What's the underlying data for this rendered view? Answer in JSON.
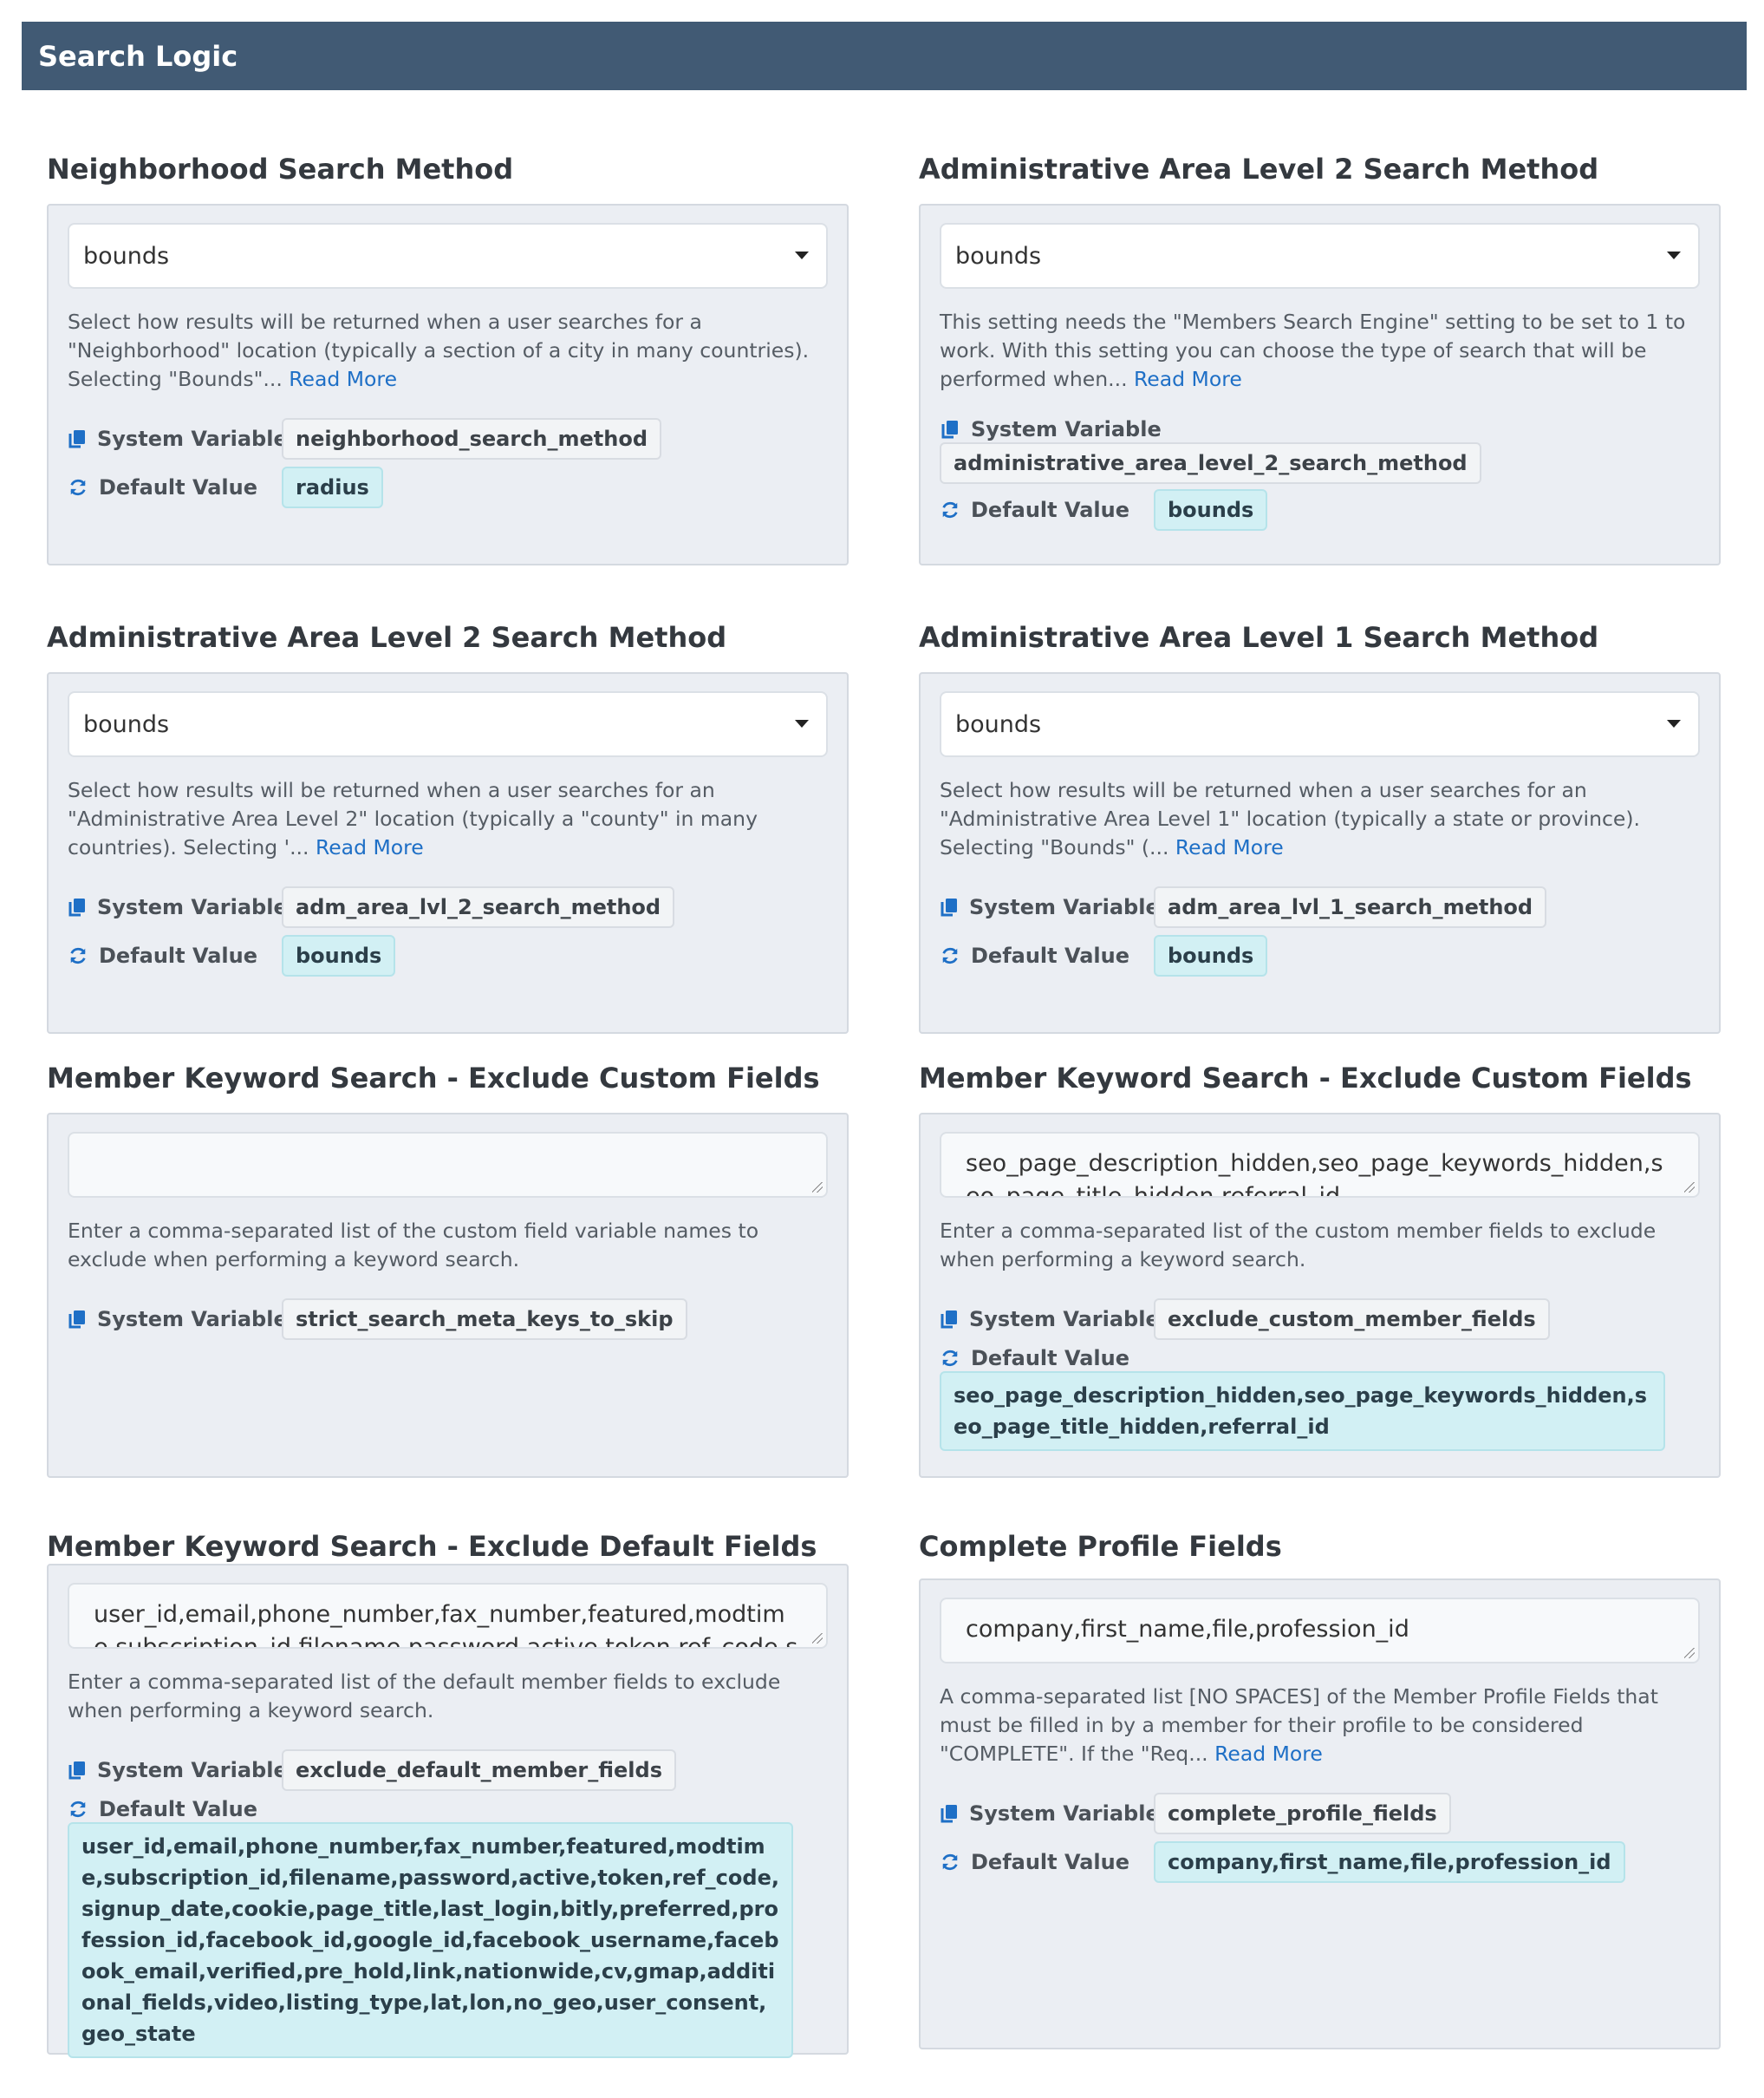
{
  "header": {
    "title": "Search Logic"
  },
  "labels": {
    "system_variable": "System Variable",
    "default_value": "Default Value",
    "read_more": "Read More"
  },
  "settings": [
    {
      "title": "Neighborhood Search Method",
      "select_value": "bounds",
      "description": "Select how results will be returned when a user searches for a \"Neighborhood\" location (typically a section of a city in many countries). Selecting \"Bounds\"... ",
      "system_variable": "neighborhood_search_method",
      "default_value": "radius"
    },
    {
      "title": "Administrative Area Level 2 Search Method",
      "select_value": "bounds",
      "description": "This setting needs the \"Members Search Engine\" setting to be set to 1 to work. With this setting you can choose the type of search that will be performed when... ",
      "system_variable": "administrative_area_level_2_search_method",
      "default_value": "bounds"
    },
    {
      "title": "Administrative Area Level 2 Search Method",
      "select_value": "bounds",
      "description": "Select how results will be returned when a user searches for an \"Administrative Area Level 2\" location (typically a \"county\" in many countries). Selecting '... ",
      "system_variable": "adm_area_lvl_2_search_method",
      "default_value": "bounds"
    },
    {
      "title": "Administrative Area Level 1 Search Method",
      "select_value": "bounds",
      "description": "Select how results will be returned when a user searches for an \"Administrative Area Level 1\" location (typically a state or province). Selecting \"Bounds\" (... ",
      "system_variable": "adm_area_lvl_1_search_method",
      "default_value": "bounds"
    },
    {
      "title": "Member Keyword Search - Exclude Custom Fields",
      "textarea_value": "",
      "description": "Enter a comma-separated list of the custom field variable names to exclude when performing a keyword search.",
      "system_variable": "strict_search_meta_keys_to_skip"
    },
    {
      "title": "Member Keyword Search - Exclude Custom Fields",
      "textarea_value": "seo_page_description_hidden,seo_page_keywords_hidden,seo_page_title_hidden,referral_id",
      "description": "Enter a comma-separated list of the custom member fields to exclude when performing a keyword search.",
      "system_variable": "exclude_custom_member_fields",
      "default_value": "seo_page_description_hidden,seo_page_keywords_hidden,seo_page_title_hidden,referral_id"
    },
    {
      "title": "Member Keyword Search - Exclude Default Fields",
      "textarea_value": "user_id,email,phone_number,fax_number,featured,modtime,subscription_id,filename,password,active,token,ref_code,signup_date,cookie",
      "description": "Enter a comma-separated list of the default member fields to exclude when performing a keyword search.",
      "system_variable": "exclude_default_member_fields",
      "default_value": "user_id,email,phone_number,fax_number,featured,modtime,subscription_id,filename,password,active,token,ref_code,signup_date,cookie,page_title,last_login,bitly,preferred,profession_id,facebook_id,google_id,facebook_username,facebook_email,verified,pre_hold,link,nationwide,cv,gmap,additional_fields,video,listing_type,lat,lon,no_geo,user_consent,geo_state"
    },
    {
      "title": "Complete Profile Fields",
      "textarea_value": "company,first_name,file,profession_id",
      "description": "A comma-separated list [NO SPACES] of the Member Profile Fields that must be filled in by a member for their profile to be considered \"COMPLETE\". If the \"Req... ",
      "system_variable": "complete_profile_fields",
      "default_value": "company,first_name,file,profession_id"
    }
  ]
}
